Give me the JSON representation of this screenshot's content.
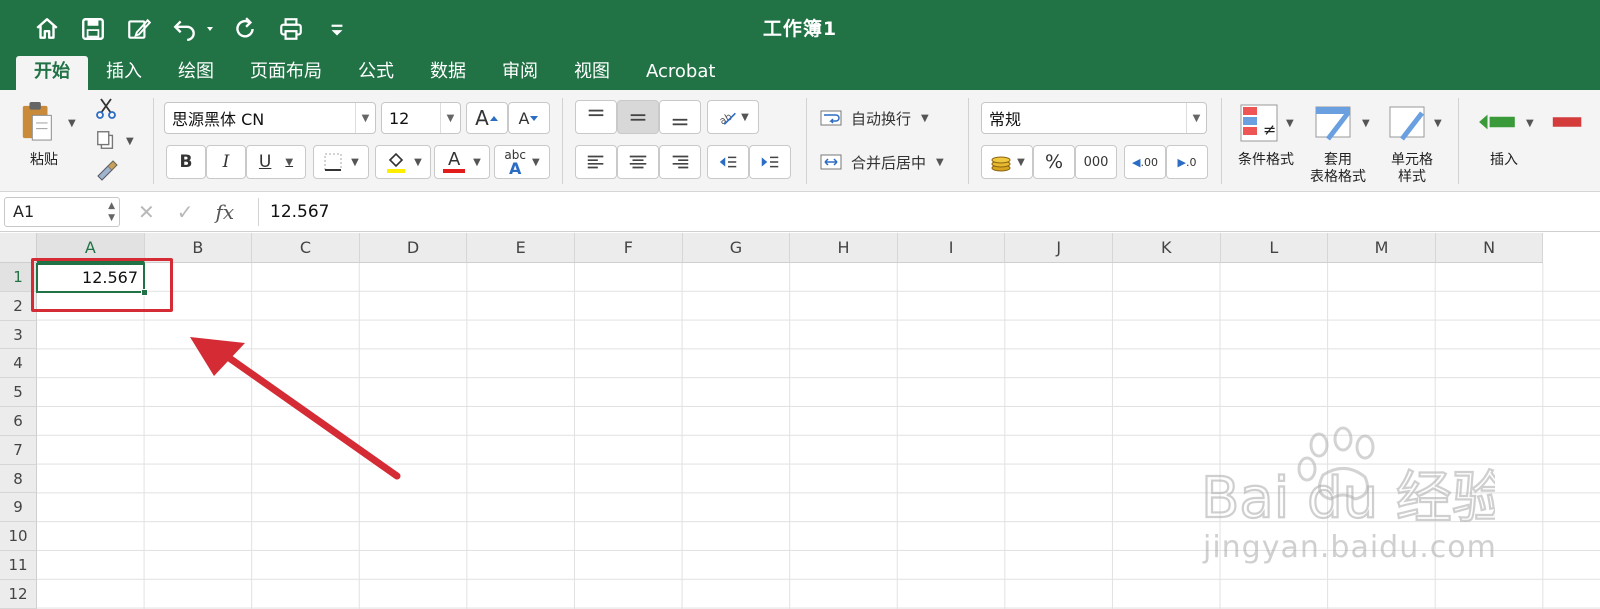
{
  "window": {
    "title": "工作簿1"
  },
  "tabs": [
    "开始",
    "插入",
    "绘图",
    "页面布局",
    "公式",
    "数据",
    "审阅",
    "视图",
    "Acrobat"
  ],
  "active_tab": "开始",
  "ribbon": {
    "paste_label": "粘贴",
    "font_name": "思源黑体 CN",
    "font_size": "12",
    "wrap_text": "自动换行",
    "merge_center": "合并后居中",
    "number_format": "常规",
    "percent": "%",
    "thousands": "000",
    "cond_format": "条件格式",
    "table_format_l1": "套用",
    "table_format_l2": "表格格式",
    "cell_style_l1": "单元格",
    "cell_style_l2": "样式",
    "insert": "插入",
    "bold": "B",
    "italic": "I",
    "underline": "U",
    "font_color_letter": "A",
    "abc": "abc",
    "inc_decimal": ".00",
    "dec_decimal": ".0"
  },
  "formula_bar": {
    "name_box": "A1",
    "fx": "fx",
    "content": "12.567"
  },
  "sheet": {
    "columns": [
      "A",
      "B",
      "C",
      "D",
      "E",
      "F",
      "G",
      "H",
      "I",
      "J",
      "K",
      "L",
      "M",
      "N"
    ],
    "rows": [
      "1",
      "2",
      "3",
      "4",
      "5",
      "6",
      "7",
      "8",
      "9",
      "10",
      "11",
      "12"
    ],
    "active_cell": "A1",
    "a1_value": "12.567"
  },
  "watermark": {
    "brand": "Bai du 经验",
    "url": "jingyan.baidu.com"
  },
  "colors": {
    "accent": "#217346",
    "highlight": "#d42b34",
    "fill_yellow": "#ffee00",
    "font_red": "#e21b1b"
  }
}
